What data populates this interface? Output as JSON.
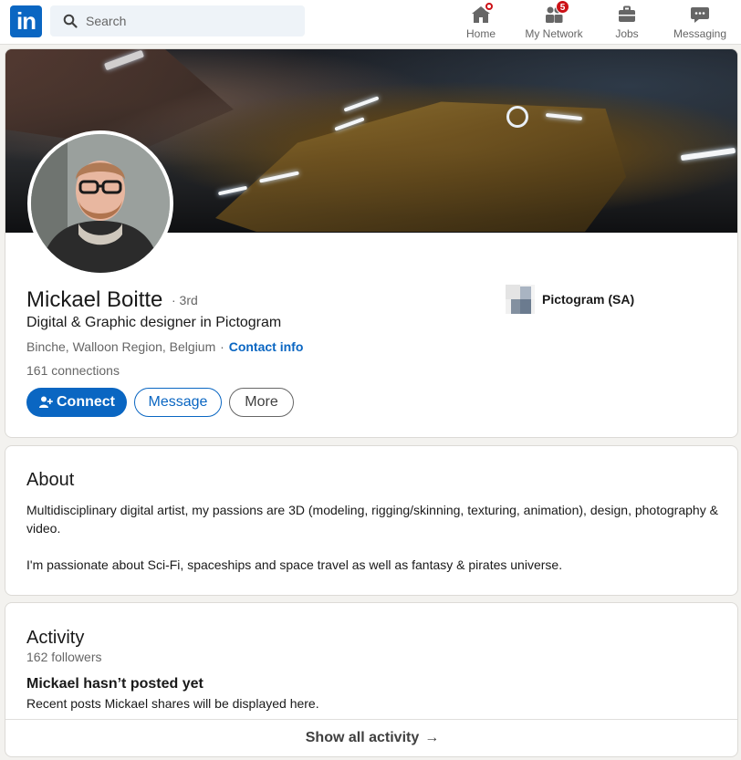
{
  "nav": {
    "logo_text": "in",
    "search_placeholder": "Search",
    "items": [
      {
        "label": "Home",
        "icon": "home-icon"
      },
      {
        "label": "My Network",
        "icon": "network-icon",
        "badge": "5"
      },
      {
        "label": "Jobs",
        "icon": "briefcase-icon"
      },
      {
        "label": "Messaging",
        "icon": "chat-icon"
      }
    ]
  },
  "profile": {
    "name": "Mickael Boitte",
    "degree": "· 3rd",
    "headline": "Digital & Graphic designer in Pictogram",
    "location": "Binche, Walloon Region, Belgium",
    "location_sep": "·",
    "contact_info": "Contact info",
    "connections": "161 connections",
    "company": "Pictogram (SA)",
    "buttons": {
      "connect": "Connect",
      "message": "Message",
      "more": "More"
    }
  },
  "about": {
    "title": "About",
    "paragraphs": [
      "Multidisciplinary digital artist, my passions are 3D (modeling, rigging/skinning, texturing, animation), design, photography & video.",
      "I'm passionate about Sci-Fi, spaceships and space travel as well as fantasy & pirates universe."
    ]
  },
  "activity": {
    "title": "Activity",
    "followers": "162 followers",
    "empty_title": "Mickael hasn’t posted yet",
    "empty_sub": "Recent posts Mickael shares will be displayed here.",
    "show_all": "Show all activity",
    "show_all_arrow": "→"
  },
  "colors": {
    "brand": "#0a66c2",
    "notification": "#cc1016",
    "background": "#f3f2ef"
  }
}
